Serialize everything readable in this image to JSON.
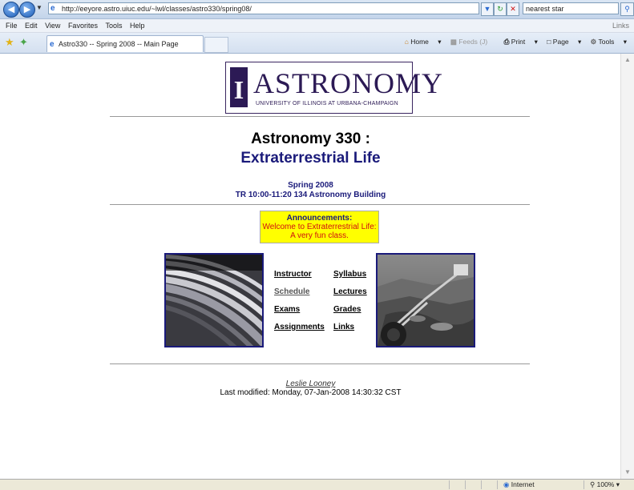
{
  "browser": {
    "url": "http://eeyore.astro.uiuc.edu/~lwl/classes/astro330/spring08/",
    "search_value": "nearest star",
    "menu": [
      "File",
      "Edit",
      "View",
      "Favorites",
      "Tools",
      "Help"
    ],
    "links_label": "Links",
    "tab_title": "Astro330 -- Spring 2008 -- Main Page",
    "commands": {
      "home": "Home",
      "feeds": "Feeds (J)",
      "print": "Print",
      "page": "Page",
      "tools": "Tools"
    },
    "status": {
      "zone": "Internet",
      "zoom": "100%"
    }
  },
  "logo": {
    "mark": "I",
    "word": "ASTRONOMY",
    "sub": "UNIVERSITY OF ILLINOIS AT URBANA-CHAMPAIGN"
  },
  "course": {
    "title_line1": "Astronomy 330 :",
    "title_line2": "Extraterrestrial Life",
    "semester": "Spring 2008",
    "schedule": "TR 10:00-11:20 134 Astronomy Building"
  },
  "announcements": {
    "heading": "Announcements:",
    "line1": "Welcome to Extraterrestrial Life:",
    "line2": "A very fun class."
  },
  "nav_links": {
    "instructor": "Instructor",
    "syllabus": "Syllabus",
    "schedule": "Schedule",
    "lectures": "Lectures",
    "exams": "Exams",
    "grades": "Grades",
    "assignments": "Assignments",
    "links": "Links"
  },
  "footer": {
    "author": "Leslie Looney",
    "modified": "Last modified: Monday, 07-Jan-2008 14:30:32 CST"
  }
}
